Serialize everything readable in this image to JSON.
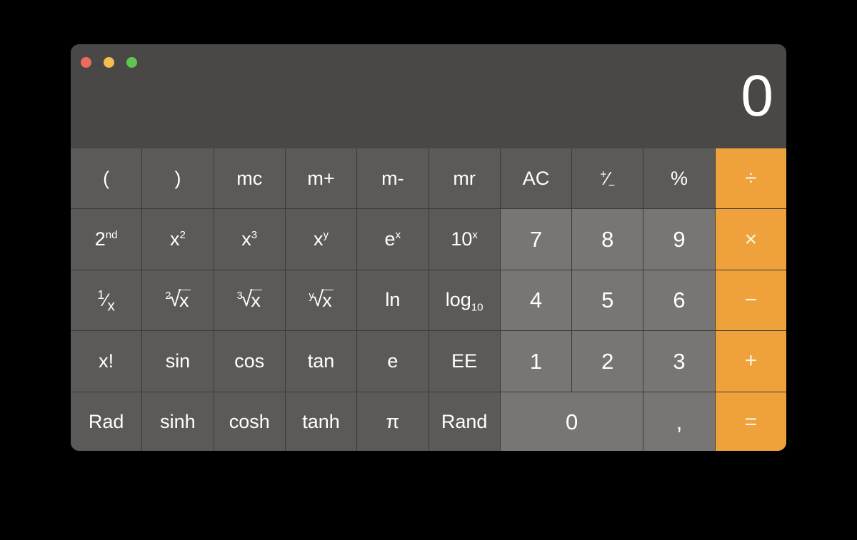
{
  "app": {
    "name": "Calculator",
    "mode": "Scientific"
  },
  "window_controls": {
    "close": {
      "name": "close",
      "color": "#ec6a5e"
    },
    "minimize": {
      "name": "minimize",
      "color": "#f3bd4f"
    },
    "zoom": {
      "name": "zoom",
      "color": "#61c554"
    }
  },
  "display": {
    "value": "0"
  },
  "colors": {
    "page_background": "#000000",
    "window_background": "#4a4846",
    "titlebar": "#4a4846",
    "function_key": "#5c5a58",
    "number_key": "#787674",
    "operator_key": "#efa13c",
    "key_divider": "#3c3a38",
    "label": "#ffffff"
  },
  "keypad": {
    "columns": 10,
    "rows": [
      {
        "row": 1,
        "keys": [
          {
            "label": "(",
            "type": "function",
            "name": "open-paren"
          },
          {
            "label": ")",
            "type": "function",
            "name": "close-paren"
          },
          {
            "label": "mc",
            "type": "function",
            "name": "memory-clear"
          },
          {
            "label": "m+",
            "type": "function",
            "name": "memory-add"
          },
          {
            "label": "m-",
            "type": "function",
            "name": "memory-subtract"
          },
          {
            "label": "mr",
            "type": "function",
            "name": "memory-recall"
          },
          {
            "label": "AC",
            "type": "function",
            "name": "all-clear"
          },
          {
            "label": "+/-",
            "type": "function",
            "name": "plus-minus",
            "glyph": "plus-minus"
          },
          {
            "label": "%",
            "type": "function",
            "name": "percent"
          },
          {
            "label": "÷",
            "type": "operator",
            "name": "divide"
          }
        ]
      },
      {
        "row": 2,
        "keys": [
          {
            "label": "2nd",
            "type": "function",
            "name": "second-function",
            "base": "2",
            "sup": "nd"
          },
          {
            "label": "x2",
            "type": "function",
            "name": "x-squared",
            "base": "x",
            "sup": "2"
          },
          {
            "label": "x3",
            "type": "function",
            "name": "x-cubed",
            "base": "x",
            "sup": "3"
          },
          {
            "label": "xy",
            "type": "function",
            "name": "x-to-the-y",
            "base": "x",
            "sup": "y"
          },
          {
            "label": "ex",
            "type": "function",
            "name": "e-to-the-x",
            "base": "e",
            "sup": "x"
          },
          {
            "label": "10x",
            "type": "function",
            "name": "ten-to-the-x",
            "base": "10",
            "sup": "x"
          },
          {
            "label": "7",
            "type": "number",
            "name": "digit-7"
          },
          {
            "label": "8",
            "type": "number",
            "name": "digit-8"
          },
          {
            "label": "9",
            "type": "number",
            "name": "digit-9"
          },
          {
            "label": "×",
            "type": "operator",
            "name": "multiply"
          }
        ]
      },
      {
        "row": 3,
        "keys": [
          {
            "label": "1/x",
            "type": "function",
            "name": "reciprocal",
            "glyph": "one-over-x"
          },
          {
            "label": "2√x",
            "type": "function",
            "name": "square-root",
            "glyph": "radical",
            "index": "2",
            "arg": "x"
          },
          {
            "label": "3√x",
            "type": "function",
            "name": "cube-root",
            "glyph": "radical",
            "index": "3",
            "arg": "x"
          },
          {
            "label": "y√x",
            "type": "function",
            "name": "y-root-of-x",
            "glyph": "radical",
            "index": "y",
            "arg": "x"
          },
          {
            "label": "ln",
            "type": "function",
            "name": "natural-log"
          },
          {
            "label": "log10",
            "type": "function",
            "name": "log-base-10",
            "base": "log",
            "sub": "10"
          },
          {
            "label": "4",
            "type": "number",
            "name": "digit-4"
          },
          {
            "label": "5",
            "type": "number",
            "name": "digit-5"
          },
          {
            "label": "6",
            "type": "number",
            "name": "digit-6"
          },
          {
            "label": "−",
            "type": "operator",
            "name": "subtract"
          }
        ]
      },
      {
        "row": 4,
        "keys": [
          {
            "label": "x!",
            "type": "function",
            "name": "factorial"
          },
          {
            "label": "sin",
            "type": "function",
            "name": "sine"
          },
          {
            "label": "cos",
            "type": "function",
            "name": "cosine"
          },
          {
            "label": "tan",
            "type": "function",
            "name": "tangent"
          },
          {
            "label": "e",
            "type": "function",
            "name": "euler-constant"
          },
          {
            "label": "EE",
            "type": "function",
            "name": "exponent-entry"
          },
          {
            "label": "1",
            "type": "number",
            "name": "digit-1"
          },
          {
            "label": "2",
            "type": "number",
            "name": "digit-2"
          },
          {
            "label": "3",
            "type": "number",
            "name": "digit-3"
          },
          {
            "label": "+",
            "type": "operator",
            "name": "add"
          }
        ]
      },
      {
        "row": 5,
        "keys": [
          {
            "label": "Rad",
            "type": "function",
            "name": "radians-mode"
          },
          {
            "label": "sinh",
            "type": "function",
            "name": "hyperbolic-sine"
          },
          {
            "label": "cosh",
            "type": "function",
            "name": "hyperbolic-cosine"
          },
          {
            "label": "tanh",
            "type": "function",
            "name": "hyperbolic-tangent"
          },
          {
            "label": "π",
            "type": "function",
            "name": "pi-constant"
          },
          {
            "label": "Rand",
            "type": "function",
            "name": "random-number"
          },
          {
            "label": "0",
            "type": "number",
            "name": "digit-0",
            "span": 2
          },
          {
            "label": ",",
            "type": "number",
            "name": "decimal-separator"
          },
          {
            "label": "=",
            "type": "operator",
            "name": "equals"
          }
        ]
      }
    ]
  }
}
